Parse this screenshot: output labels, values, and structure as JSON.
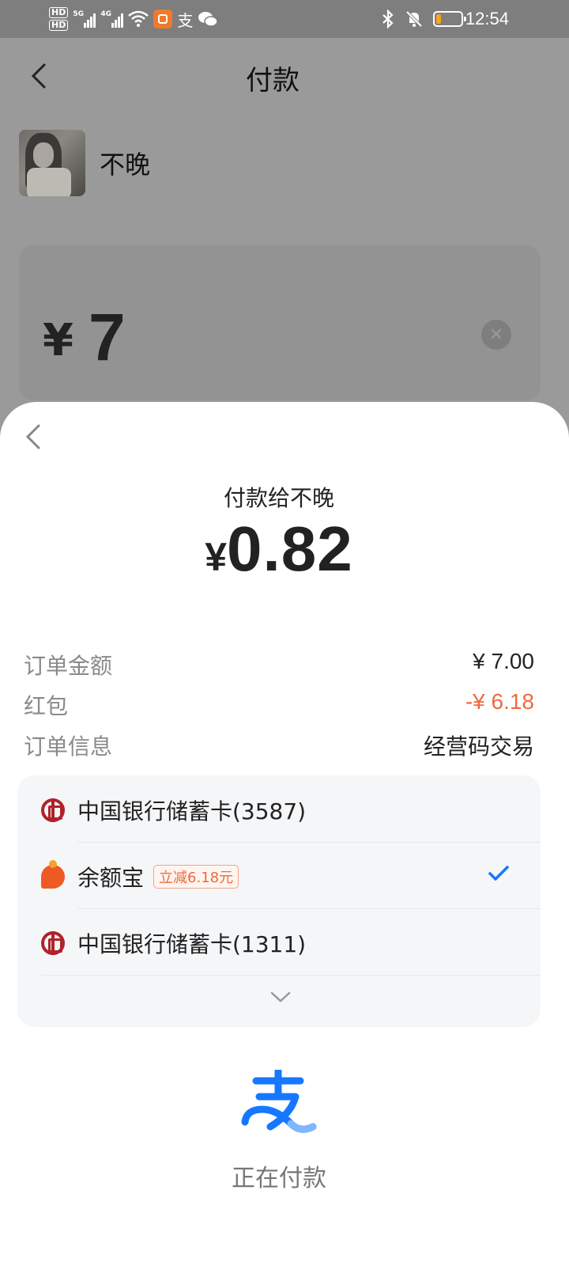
{
  "status_bar": {
    "hd1": "HD",
    "hd2": "HD",
    "net1": "5G",
    "net2": "4G",
    "time": "12:54",
    "battery_level": 0.2
  },
  "nav": {
    "title": "付款"
  },
  "payee": {
    "name": "不晚"
  },
  "amount_input": {
    "currency": "¥",
    "value": "7"
  },
  "sheet": {
    "subtitle": "付款给不晚",
    "currency": "¥",
    "amount": "0.82",
    "details": [
      {
        "label": "订单金额",
        "value": "¥ 7.00"
      },
      {
        "label": "红包",
        "value": "-¥ 6.18"
      },
      {
        "label": "订单信息",
        "value": "经营码交易"
      }
    ],
    "methods": [
      {
        "name": "中国银行储蓄卡(3587)"
      },
      {
        "name": "余额宝",
        "badge": "立减6.18元",
        "selected": true
      },
      {
        "name": "中国银行储蓄卡(1311)"
      }
    ],
    "paying_text": "正在付款"
  },
  "colors": {
    "accent": "#1677ff",
    "discount": "#ee6a3e",
    "boc_red": "#b0232a"
  }
}
